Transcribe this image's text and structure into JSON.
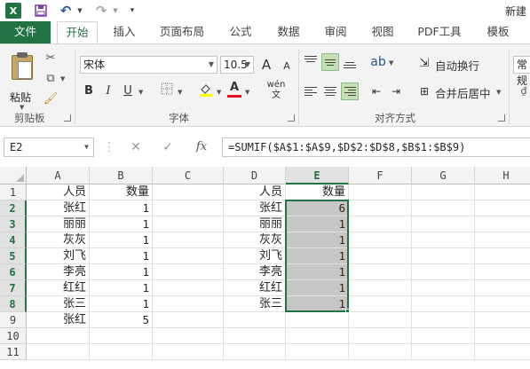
{
  "titlebar": {
    "app_icon": "X",
    "title": "新建",
    "icons": [
      "excel-icon",
      "save-icon",
      "undo-icon",
      "redo-icon",
      "customize-icon"
    ]
  },
  "tabs": [
    "文件",
    "开始",
    "插入",
    "页面布局",
    "公式",
    "数据",
    "审阅",
    "视图",
    "PDF工具",
    "模板"
  ],
  "active_tab": "开始",
  "ribbon": {
    "clipboard": {
      "paste_label": "粘贴",
      "group_label": "剪贴板"
    },
    "font": {
      "font_name": "宋体",
      "font_size": "10.5",
      "bold": "B",
      "italic": "I",
      "underline": "U",
      "group_label": "字体",
      "grow": "A",
      "shrink": "A",
      "font_color_letter": "A",
      "phonetic": "wén"
    },
    "alignment": {
      "wrap_text": "自动换行",
      "merge_center": "合并后居中",
      "group_label": "对齐方式"
    },
    "number": {
      "format": "常规"
    }
  },
  "formula_bar": {
    "name_box": "E2",
    "formula": "=SUMIF($A$1:$A$9,$D$2:$D$8,$B$1:$B$9)",
    "fx": "fx"
  },
  "sheet": {
    "columns": [
      "A",
      "B",
      "C",
      "D",
      "E",
      "F",
      "G",
      "H"
    ],
    "active_column": "E",
    "rows": [
      "1",
      "2",
      "3",
      "4",
      "5",
      "6",
      "7",
      "8",
      "9",
      "10",
      "11"
    ],
    "active_rows": [
      "2",
      "3",
      "4",
      "5",
      "6",
      "7",
      "8"
    ],
    "cells": {
      "A": [
        "人员",
        "张红",
        "丽丽",
        "灰灰",
        "刘飞",
        "李亮",
        "红红",
        "张三",
        "张红",
        "",
        ""
      ],
      "B": [
        "数量",
        "1",
        "1",
        "1",
        "1",
        "1",
        "1",
        "1",
        "5",
        "",
        ""
      ],
      "D": [
        "人员",
        "张红",
        "丽丽",
        "灰灰",
        "刘飞",
        "李亮",
        "红红",
        "张三",
        "",
        "",
        ""
      ],
      "E": [
        "数量",
        "6",
        "1",
        "1",
        "1",
        "1",
        "1",
        "1",
        "",
        "",
        ""
      ]
    },
    "selection": "E2:E8",
    "highlight_color": "#c6c6c6",
    "accent_color": "#217346"
  }
}
